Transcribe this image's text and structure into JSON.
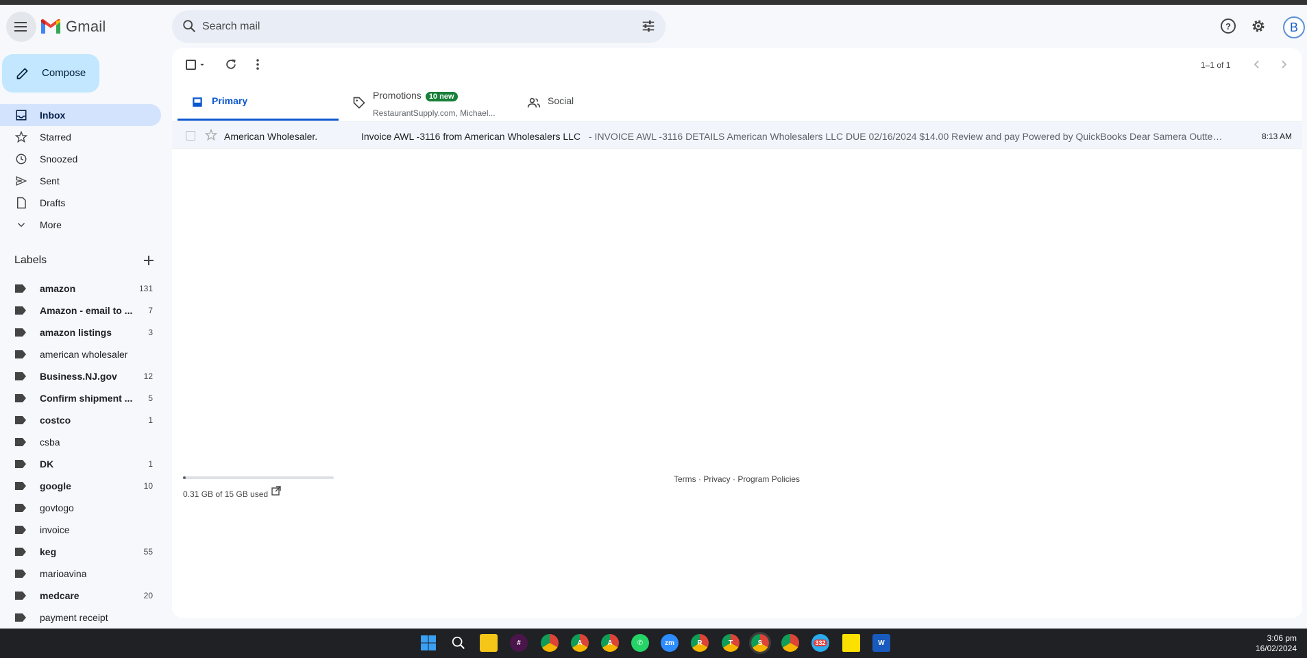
{
  "app": {
    "name": "Gmail"
  },
  "search": {
    "placeholder": "Search mail"
  },
  "compose": {
    "label": "Compose"
  },
  "nav": [
    {
      "label": "Inbox",
      "icon": "inbox-icon",
      "active": true
    },
    {
      "label": "Starred",
      "icon": "star-icon"
    },
    {
      "label": "Snoozed",
      "icon": "clock-icon"
    },
    {
      "label": "Sent",
      "icon": "send-icon"
    },
    {
      "label": "Drafts",
      "icon": "draft-icon"
    },
    {
      "label": "More",
      "icon": "chevron-down-icon"
    }
  ],
  "labels_header": "Labels",
  "labels": [
    {
      "name": "amazon",
      "count": "131",
      "bold": true
    },
    {
      "name": "Amazon - email to ...",
      "count": "7",
      "bold": true
    },
    {
      "name": "amazon listings",
      "count": "3",
      "bold": true
    },
    {
      "name": "american wholesaler",
      "count": "",
      "bold": false
    },
    {
      "name": "Business.NJ.gov",
      "count": "12",
      "bold": true
    },
    {
      "name": "Confirm shipment ...",
      "count": "5",
      "bold": true
    },
    {
      "name": "costco",
      "count": "1",
      "bold": true
    },
    {
      "name": "csba",
      "count": "",
      "bold": false
    },
    {
      "name": "DK",
      "count": "1",
      "bold": true
    },
    {
      "name": "google",
      "count": "10",
      "bold": true
    },
    {
      "name": "govtogo",
      "count": "",
      "bold": false
    },
    {
      "name": "invoice",
      "count": "",
      "bold": false
    },
    {
      "name": "keg",
      "count": "55",
      "bold": true
    },
    {
      "name": "marioavina",
      "count": "",
      "bold": false
    },
    {
      "name": "medcare",
      "count": "20",
      "bold": true
    },
    {
      "name": "payment receipt",
      "count": "",
      "bold": false
    }
  ],
  "pager": "1–1 of 1",
  "tabs": {
    "primary": "Primary",
    "promotions": "Promotions",
    "promotions_badge": "10 new",
    "promotions_sub": "RestaurantSupply.com, Michael...",
    "social": "Social"
  },
  "email": {
    "sender": "American Wholesaler.",
    "subject": "Invoice AWL -3116 from American Wholesalers LLC",
    "snippet": " - INVOICE AWL -3116 DETAILS American Wholesalers LLC DUE 02/16/2024 $14.00 Review and pay Powered by QuickBooks Dear Samera Outten, W...",
    "time": "8:13 AM"
  },
  "storage": {
    "text": "0.31 GB of 15 GB used",
    "fraction": 0.02
  },
  "footer": {
    "terms": "Terms",
    "privacy": "Privacy",
    "policies": "Program Policies",
    "sep": " · "
  },
  "avatar": {
    "letter": "B"
  },
  "taskbar": {
    "time": "3:06 pm",
    "date": "16/02/2024",
    "badges": {
      "zoom": "zm",
      "telegram": "332",
      "chrome_a1": "A",
      "chrome_a2": "A",
      "chrome_r": "R",
      "chrome_t": "T",
      "chrome_s": "S"
    }
  },
  "colors": {
    "accent": "#0b57d0",
    "compose_bg": "#c2e7ff",
    "active_nav": "#d3e3fd",
    "badge_green": "#188038"
  }
}
